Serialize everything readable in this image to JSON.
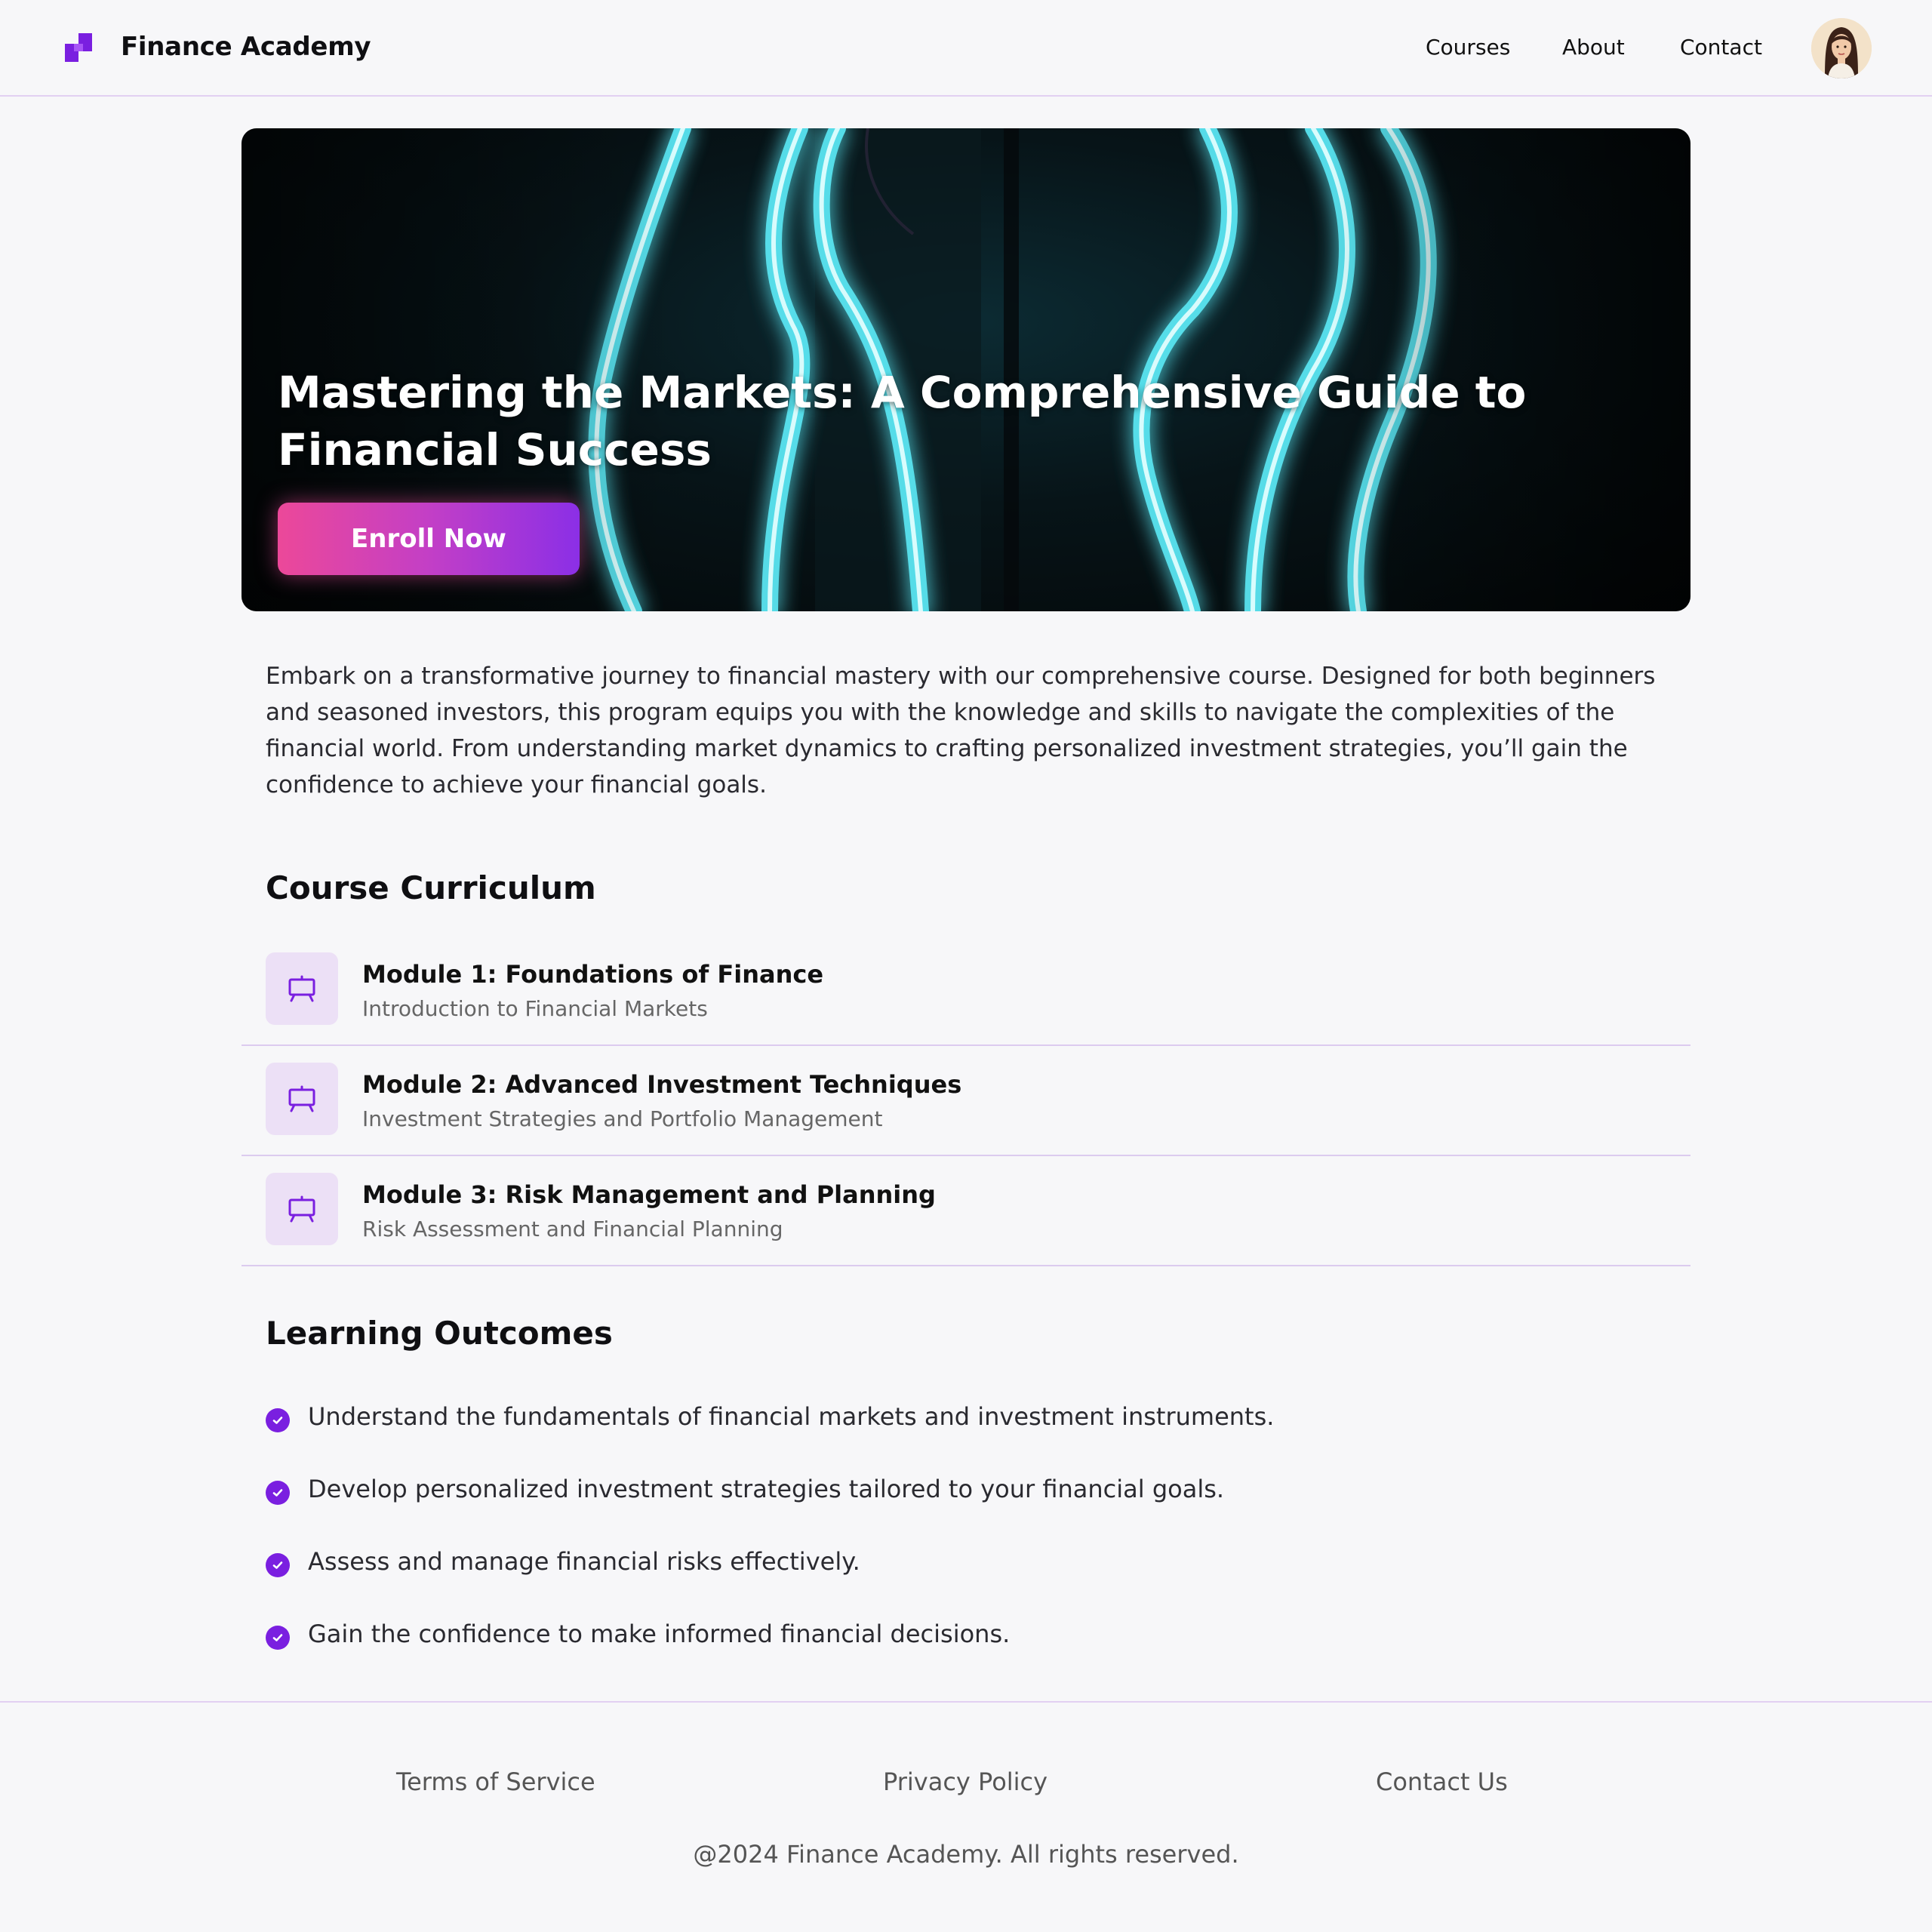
{
  "header": {
    "brand": "Finance Academy",
    "logo_icon": "logo-icon",
    "nav": [
      "Courses",
      "About",
      "Contact"
    ],
    "avatar_icon": "avatar"
  },
  "hero": {
    "title": "Mastering the Markets: A Comprehensive Guide to Financial Success",
    "cta": "Enroll Now",
    "accent_gradient": [
      "#ec4899",
      "#8b2fe6"
    ]
  },
  "description": "Embark on a transformative journey to financial mastery with our comprehensive course. Designed for both beginners and seasoned investors, this program equips you with the knowledge and skills to navigate the complexities of the financial world. From understanding market dynamics to crafting personalized investment strategies, you’ll gain the confidence to achieve your financial goals.",
  "curriculum": {
    "title": "Course Curriculum",
    "modules": [
      {
        "title": "Module 1: Foundations of Finance",
        "subtitle": "Introduction to Financial Markets",
        "icon": "presentation-icon"
      },
      {
        "title": "Module 2: Advanced Investment Techniques",
        "subtitle": "Investment Strategies and Portfolio Management",
        "icon": "presentation-icon"
      },
      {
        "title": "Module 3: Risk Management and Planning",
        "subtitle": "Risk Assessment and Financial Planning",
        "icon": "presentation-icon"
      }
    ]
  },
  "outcomes": {
    "title": "Learning Outcomes",
    "items": [
      "Understand the fundamentals of financial markets and investment instruments.",
      "Develop personalized investment strategies tailored to your financial goals.",
      "Assess and manage financial risks effectively.",
      "Gain the confidence to make informed financial decisions."
    ],
    "icon": "check-circle-icon"
  },
  "footer": {
    "links": [
      "Terms of Service",
      "Privacy Policy",
      "Contact Us"
    ],
    "copyright": "@2024 Finance Academy. All rights reserved."
  },
  "colors": {
    "accent": "#7a1fe0",
    "icon_bg": "#ece0f6",
    "divider": "#dccbef",
    "page_bg": "#f7f7f9"
  }
}
